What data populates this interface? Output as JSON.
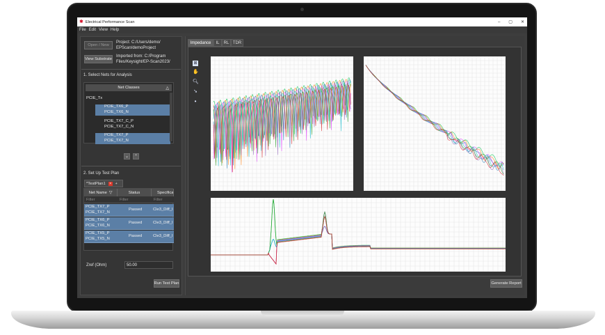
{
  "window": {
    "title": "Electrical Performance Scan",
    "controls": [
      "–",
      "▢",
      "✕"
    ]
  },
  "menu": [
    "File",
    "Edit",
    "View",
    "Help"
  ],
  "project": {
    "open_label": "Open / New",
    "view_substrate_label": "View Substrate",
    "project_line1": "Project: C:/Users/demo/",
    "project_line2": "EPScan/demoProject",
    "imported_line1": "Imported from: C:/Program",
    "imported_line2": "Files/Keysight/EP-Scan2023/"
  },
  "nets": {
    "section_title": "1. Select Nets for Analysis",
    "header": "Net Classes",
    "group": "PCIE_Tx",
    "items": [
      {
        "label": "PCIE_TX6_P",
        "selected": true
      },
      {
        "label": "PCIE_TX6_N",
        "selected": true
      },
      {
        "label": "PCIE_TX7_C_P",
        "selected": false
      },
      {
        "label": "PCIE_TX7_C_N",
        "selected": false
      },
      {
        "label": "PCIE_TX7_P",
        "selected": true
      },
      {
        "label": "PCIE_TX7_N",
        "selected": true
      }
    ],
    "down_label": "⌄",
    "up_label": "⌃"
  },
  "testplan": {
    "section_title": "2. Set Up Test Plan",
    "tab_label": "*TestPlan1",
    "columns": [
      "Net Name",
      "Status",
      "Specification"
    ],
    "filter_placeholder": "Filter",
    "rows": [
      {
        "net1": "PCIE_TX7_P",
        "net2": "PCIE_TX7_N",
        "status": "Passed",
        "spec": "Cle3_Diff_I"
      },
      {
        "net1": "PCIE_TX6_P",
        "net2": "PCIE_TX6_N",
        "status": "Passed",
        "spec": "Cle3_Diff_I"
      },
      {
        "net1": "PCIE_TX5_P",
        "net2": "PCIE_TX5_N",
        "status": "Passed",
        "spec": "Cle3_Diff_I"
      }
    ],
    "zref_label": "Zref (Ohm)",
    "zref_value": "50.00",
    "run_label": "Run Test Plan"
  },
  "plots": {
    "tabs": [
      "Impedance",
      "IL",
      "RL",
      "TDR"
    ],
    "active_tab": "Impedance",
    "generate_label": "Generate Report",
    "tools": [
      "zoom-fit-icon",
      "pan-hand-icon",
      "zoom-icon",
      "pointer-icon",
      "marker-dot-icon"
    ],
    "series_colors": [
      "#00c64f",
      "#ff7f0e",
      "#1f77b4",
      "#e040fb",
      "#17becf",
      "#9467bd",
      "#2ca02c",
      "#d62728"
    ]
  }
}
